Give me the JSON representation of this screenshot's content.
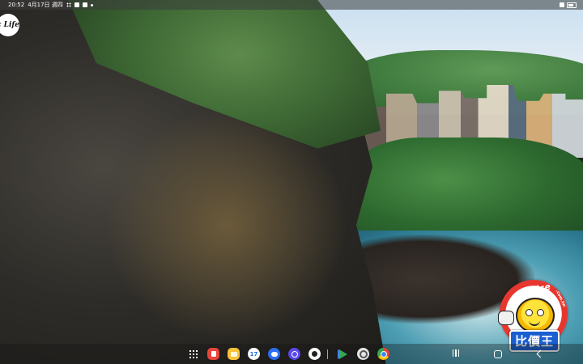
{
  "status_bar": {
    "time": "20:52",
    "date": "4月17日 週四",
    "icons": [
      "grid-icon",
      "sim-icon",
      "lock-icon",
      "dot-icon"
    ],
    "right_icons": [
      "wifi-icon",
      "battery-icon"
    ]
  },
  "overlays": {
    "life_logo": "c Life",
    "eprice_wordmark": "ePrice",
    "eprice_domain": ".com.tw",
    "eprice_chinese": "比價王"
  },
  "taskbar": {
    "apps": [
      {
        "name": "notes",
        "icon": "notes-icon",
        "color": "#e8453c"
      },
      {
        "name": "my-files",
        "icon": "folder-icon",
        "color": "#f7c33b"
      },
      {
        "name": "calendar",
        "icon": "calendar-icon",
        "label": "17"
      },
      {
        "name": "messages",
        "icon": "messages-icon",
        "color": "#2f6ef2"
      },
      {
        "name": "bixby",
        "icon": "bixby-icon",
        "color": "#5b49e8"
      },
      {
        "name": "camera",
        "icon": "camera-icon"
      },
      {
        "name": "play-store",
        "icon": "play-store-icon"
      },
      {
        "name": "settings",
        "icon": "settings-icon"
      },
      {
        "name": "chrome",
        "icon": "chrome-icon"
      }
    ],
    "navigation": [
      "recent-apps-icon",
      "home-icon",
      "back-icon"
    ]
  }
}
